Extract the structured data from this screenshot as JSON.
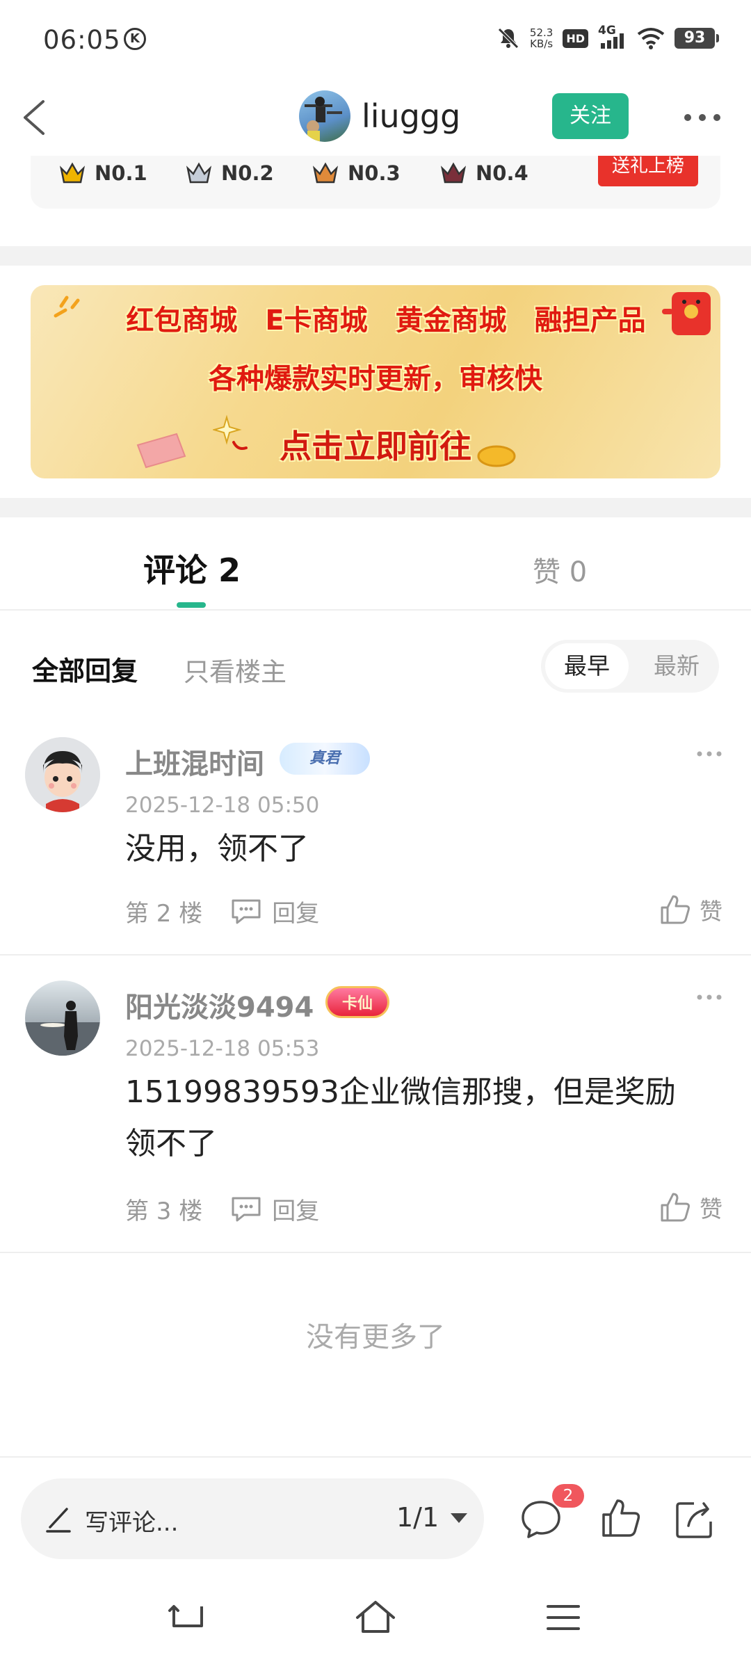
{
  "status_bar": {
    "time": "06:05",
    "k_icon": "K",
    "net_speed_value": "52.3",
    "net_speed_unit": "KB/s",
    "hd": "HD",
    "network": "4G",
    "battery": "93"
  },
  "header": {
    "author_name": "liuggg",
    "follow_label": "关注"
  },
  "rank": {
    "items": [
      "N0.1",
      "N0.2",
      "N0.3",
      "N0.4"
    ],
    "gift_label": "送礼上榜",
    "crown_colors": [
      "#f0b400",
      "#b9c3cf",
      "#e08a3a",
      "#7a2f3a"
    ]
  },
  "banner": {
    "items": [
      "红包商城",
      "E卡商城",
      "黄金商城",
      "融担产品"
    ],
    "subtitle": "各种爆款实时更新，审核快",
    "cta": "点击立即前往"
  },
  "tabs": {
    "comments_label": "评论 2",
    "likes_label": "赞 0"
  },
  "filter": {
    "all_label": "全部回复",
    "op_label": "只看楼主",
    "sort_earliest": "最早",
    "sort_latest": "最新"
  },
  "comments": [
    {
      "name": "上班混时间",
      "badge": "真君",
      "time": "2025-12-18 05:50",
      "text": "没用，领不了",
      "floor": "第 2 楼",
      "reply_label": "回复",
      "like_label": "赞"
    },
    {
      "name": "阳光淡淡9494",
      "badge": "卡仙",
      "time": "2025-12-18 05:53",
      "text_line1": "15199839593企业微信那搜，但是奖励",
      "text_line2": "领不了",
      "floor": "第 3 楼",
      "reply_label": "回复",
      "like_label": "赞"
    }
  ],
  "footer_text": "没有更多了",
  "bottom_bar": {
    "placeholder": "写评论...",
    "page": "1/1",
    "comment_count": "2"
  },
  "colors": {
    "accent": "#27b68c",
    "badge_red": "#f0575d",
    "gift_red": "#e8322b"
  }
}
